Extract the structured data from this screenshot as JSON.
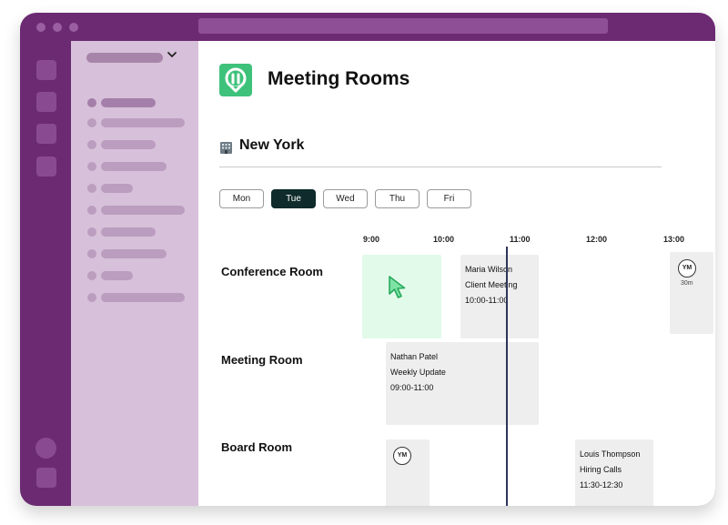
{
  "sidebar": {
    "items": [
      {
        "active": true
      },
      {
        "active": false
      },
      {
        "active": false
      },
      {
        "active": false
      },
      {
        "active": false
      },
      {
        "active": false
      },
      {
        "active": false
      },
      {
        "active": false
      },
      {
        "active": false
      },
      {
        "active": false
      }
    ]
  },
  "header": {
    "title": "Meeting Rooms",
    "logo_icon": "meeting-rooms-logo-icon",
    "accent_color": "#3ec27b"
  },
  "location": {
    "icon": "office-building-icon",
    "name": "New York"
  },
  "days": [
    {
      "label": "Mon",
      "selected": false
    },
    {
      "label": "Tue",
      "selected": true
    },
    {
      "label": "Wed",
      "selected": false
    },
    {
      "label": "Thu",
      "selected": false
    },
    {
      "label": "Fri",
      "selected": false
    }
  ],
  "timeline": {
    "times": [
      "9:00",
      "10:00",
      "11:00",
      "12:00",
      "13:00"
    ]
  },
  "rooms": [
    {
      "name": "Conference Room",
      "bookings": [
        {
          "person": "Maria Wilson",
          "title": "Client Meeting",
          "time": "10:00-11:00"
        },
        {
          "avatar": "YM",
          "duration": "30m"
        }
      ]
    },
    {
      "name": "Meeting Room",
      "bookings": [
        {
          "person": "Nathan Patel",
          "title": "Weekly Update",
          "time": "09:00-11:00"
        }
      ]
    },
    {
      "name": "Board Room",
      "bookings": [
        {
          "avatar": "YM"
        },
        {
          "person": "Louis Thompson",
          "title": "Hiring Calls",
          "time": "11:30-12:30"
        }
      ]
    }
  ],
  "colors": {
    "frame": "#6b2a72",
    "sidebar": "#d7c0d9",
    "selected_day": "#0f2b2b",
    "free_slot_highlight": "#e2faea",
    "booking": "#eeeeee",
    "now_line": "#2d355a"
  }
}
